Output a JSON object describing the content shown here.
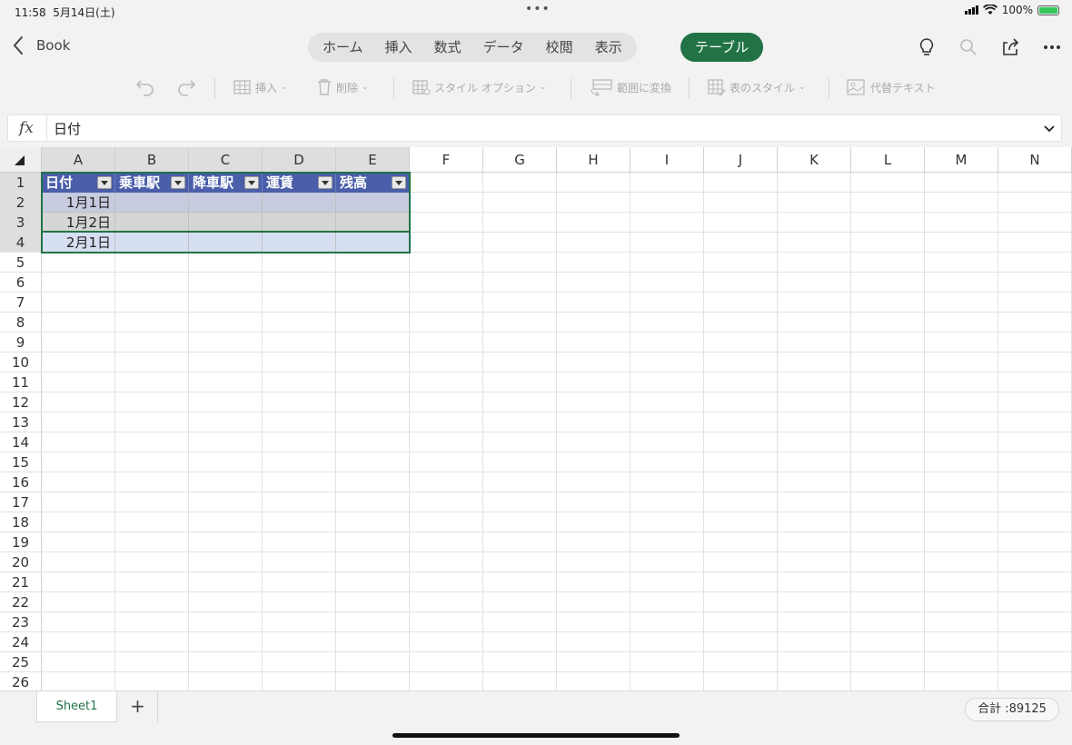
{
  "status": {
    "time": "11:58",
    "date": "5月14日(土)",
    "battery": "100%"
  },
  "nav": {
    "back_label": "Book",
    "tabs": [
      "ホーム",
      "挿入",
      "数式",
      "データ",
      "校閲",
      "表示"
    ],
    "active_tab": "テーブル",
    "accent": "#217346"
  },
  "ribbon": {
    "insert": "挿入",
    "delete": "削除",
    "style_options": "スタイル オプション",
    "convert_range": "範囲に変換",
    "table_styles": "表のスタイル",
    "alt_text": "代替テキスト"
  },
  "formula": {
    "fx": "fx",
    "value": "日付"
  },
  "grid": {
    "columns": [
      "A",
      "B",
      "C",
      "D",
      "E",
      "F",
      "G",
      "H",
      "I",
      "J",
      "K",
      "L",
      "M",
      "N"
    ],
    "rows": [
      "1",
      "2",
      "3",
      "4",
      "5",
      "6",
      "7",
      "8",
      "9",
      "10",
      "11",
      "12",
      "13",
      "14",
      "15",
      "16",
      "17",
      "18",
      "19",
      "20",
      "21",
      "22",
      "23",
      "24",
      "25",
      "26"
    ],
    "table_headers": [
      "日付",
      "乗車駅",
      "降車駅",
      "運賃",
      "残高"
    ],
    "table_rows": [
      [
        "1月1日",
        "",
        "",
        "",
        ""
      ],
      [
        "1月2日",
        "",
        "",
        "",
        ""
      ],
      [
        "2月1日",
        "",
        "",
        "",
        ""
      ]
    ],
    "header_color": "#4a5eaa"
  },
  "sheets": {
    "tabs": [
      "Sheet1"
    ],
    "add": "+",
    "sum": "合計 :89125"
  }
}
